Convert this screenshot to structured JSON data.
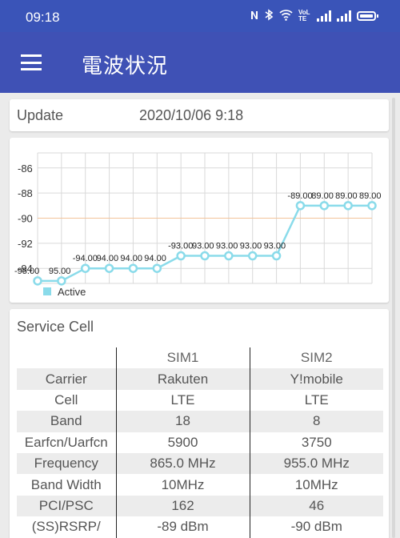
{
  "statusbar": {
    "time": "09:18",
    "icons": [
      "nfc-icon",
      "bluetooth-icon",
      "wifi-icon",
      "volte-icon",
      "signal-icon",
      "signal-icon",
      "battery-icon"
    ],
    "volte_text": "VoLTE"
  },
  "appbar": {
    "title": "電波状況",
    "menu_icon": "hamburger-menu-icon",
    "color": "#3f51b5"
  },
  "update": {
    "label": "Update",
    "value": "2020/10/06 9:18"
  },
  "chart_data": {
    "type": "line",
    "title": "",
    "xlabel": "",
    "ylabel": "",
    "ylim": [
      -95.2,
      -84.8
    ],
    "yticks": [
      "-86",
      "-88",
      "-90",
      "-92",
      "-94"
    ],
    "reference_line": -90,
    "grid": true,
    "legend": "bottom-left",
    "series": [
      {
        "name": "Active",
        "color": "#8adbea",
        "values": [
          -95,
          -95,
          -94,
          -94,
          -94,
          -94,
          -93,
          -93,
          -93,
          -93,
          -93,
          -89,
          -89,
          -89,
          -89
        ],
        "labels": [
          "-95.00",
          "95.00",
          "-94.00",
          "94.00",
          "94.00",
          "94.00",
          "-93.00",
          "93.00",
          "93.00",
          "93.00",
          "93.00",
          "-89.00",
          "89.00",
          "89.00",
          "89.00"
        ]
      }
    ]
  },
  "service_cell": {
    "heading": "Service Cell",
    "columns": [
      "",
      "SIM1",
      "SIM2"
    ],
    "rows": [
      [
        "Carrier",
        "Rakuten",
        "Y!mobile"
      ],
      [
        "Cell",
        "LTE",
        "LTE"
      ],
      [
        "Band",
        "18",
        "8"
      ],
      [
        "Earfcn/Uarfcn",
        "5900",
        "3750"
      ],
      [
        "Frequency",
        "865.0 MHz",
        "955.0 MHz"
      ],
      [
        "Band Width",
        "10MHz",
        "10MHz"
      ],
      [
        "PCI/PSC",
        "162",
        "46"
      ],
      [
        "(SS)RSRP/",
        "-89 dBm",
        "-90 dBm"
      ]
    ]
  }
}
